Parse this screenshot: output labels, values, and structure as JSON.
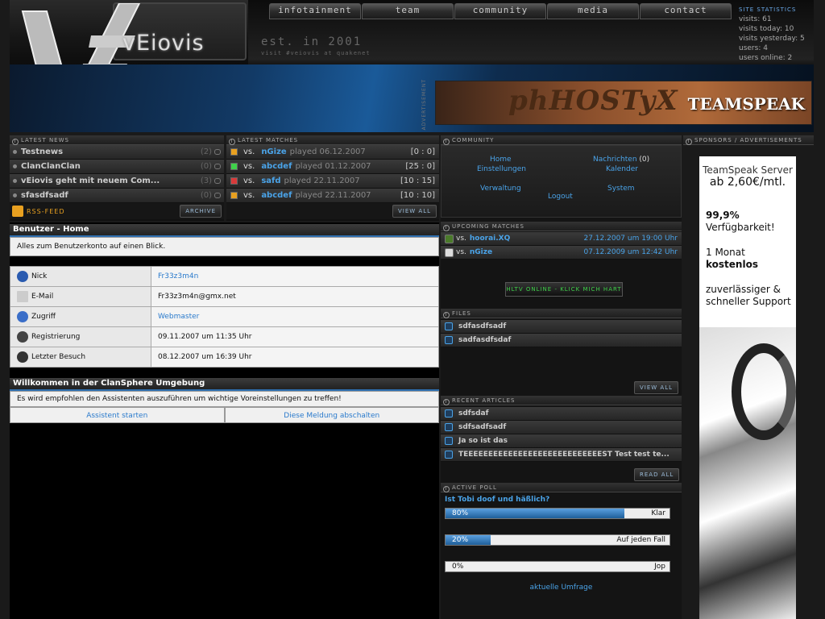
{
  "site": {
    "logo_text": "vEiovis",
    "est_text": "est. in 2001",
    "visit_text": "visit #veiovis at quakenet"
  },
  "nav": [
    {
      "label": "infotainment"
    },
    {
      "label": "team"
    },
    {
      "label": "community"
    },
    {
      "label": "media"
    },
    {
      "label": "contact"
    }
  ],
  "stats": {
    "title": "Site statistics",
    "lines": [
      "visits: 61",
      "visits today: 10",
      "visits yesterday: 5",
      "users: 4",
      "users online: 2"
    ]
  },
  "banner": {
    "adv_label": "ADVERTISEMENT",
    "ad_top": "phHOSTyX",
    "ad_bottom": "TEAMSPEAK"
  },
  "news": {
    "title": "Latest News",
    "items": [
      {
        "title": "Testnews",
        "count": "(2)"
      },
      {
        "title": "ClanClanClan",
        "count": "(0)"
      },
      {
        "title": "vEiovis geht mit neuem Com...",
        "count": "(3)"
      },
      {
        "title": "sfasdfsadf",
        "count": "(0)"
      }
    ],
    "rss_label": "RSS-Feed",
    "archive_label": "Archive"
  },
  "matches": {
    "title": "Latest Matches",
    "items": [
      {
        "vs": "vs.",
        "opponent": "nGize",
        "played": "played 06.12.2007",
        "score": "[0 : 0]",
        "status_color": "#e8a020"
      },
      {
        "vs": "vs.",
        "opponent": "abcdef",
        "played": "played 01.12.2007",
        "score": "[25 : 0]",
        "status_color": "#3fd14a"
      },
      {
        "vs": "vs.",
        "opponent": "safd",
        "played": "played 22.11.2007",
        "score": "[10 : 15]",
        "status_color": "#d83a3a"
      },
      {
        "vs": "vs.",
        "opponent": "abcdef",
        "played": "played 22.11.2007",
        "score": "[10 : 10]",
        "status_color": "#e8a020"
      }
    ],
    "view_all_label": "View all"
  },
  "content": {
    "account": {
      "heading": "Benutzer - Home",
      "subtitle": "Alles zum Benutzerkonto auf einen Blick.",
      "rows": [
        {
          "label": "Nick",
          "value": "Fr33z3m4n"
        },
        {
          "label": "E-Mail",
          "value": "Fr33z3m4n@gmx.net"
        },
        {
          "label": "Zugriff",
          "value": "Webmaster"
        },
        {
          "label": "Registrierung",
          "value": "09.11.2007 um 11:35 Uhr"
        },
        {
          "label": "Letzter Besuch",
          "value": "08.12.2007 um 16:39 Uhr"
        }
      ]
    },
    "welcome": {
      "heading": "Willkommen in der ClanSphere Umgebung",
      "text": "Es wird empfohlen den Assistenten auszuführen um wichtige Voreinstellungen zu treffen!",
      "start_label": "Assistent starten",
      "dismiss_label": "Diese Meldung abschalten"
    }
  },
  "community": {
    "title": "Community",
    "home": "Home",
    "nachrichten": "Nachrichten",
    "nachrichten_count": "(0)",
    "einstellungen": "Einstellungen",
    "kalender": "Kalender",
    "verwaltung": "Verwaltung",
    "system": "System",
    "logout": "Logout"
  },
  "upcoming": {
    "title": "Upcoming Matches",
    "items": [
      {
        "vs": "vs.",
        "opponent": "hoorai.XQ",
        "date": "27.12.2007 um 19:00 Uhr"
      },
      {
        "vs": "vs.",
        "opponent": "nGize",
        "date": "07.12.2009 um 12:42 Uhr"
      }
    ],
    "hltv_label": "HLTV ONLINE - Klick mich hart"
  },
  "files": {
    "title": "Files",
    "items": [
      "sdfasdfsadf",
      "sadfasdfsdaf"
    ],
    "view_all_label": "View all"
  },
  "articles": {
    "title": "Recent Articles",
    "items": [
      "sdfsdaf",
      "sdfsadfsadf",
      "Ja so ist das",
      "TEEEEEEEEEEEEEEEEEEEEEEEEEEEEST Test test te..."
    ],
    "read_all_label": "Read all"
  },
  "poll": {
    "title": "Active Poll",
    "question": "Ist Tobi doof und häßlich?",
    "options": [
      {
        "pct_label": "80%",
        "fill": 0.8,
        "label": "Klar"
      },
      {
        "pct_label": "20%",
        "fill": 0.2,
        "label": "Auf jeden Fall"
      },
      {
        "pct_label": "0%",
        "fill": 0.0,
        "label": "Jop"
      }
    ],
    "link_label": "aktuelle Umfrage"
  },
  "sponsors": {
    "title": "Sponsors / Advertisements",
    "ad_line1": "TeamSpeak Server",
    "ad_price": "ab 2,60€/mtl.",
    "ad_feat1a": "99,9%",
    "ad_feat1b": "Verfügbarkeit!",
    "ad_feat2a": "1 Monat",
    "ad_feat2b": "kostenlos",
    "ad_feat3a": "zuverlässiger &",
    "ad_feat3b": "schneller Support"
  }
}
